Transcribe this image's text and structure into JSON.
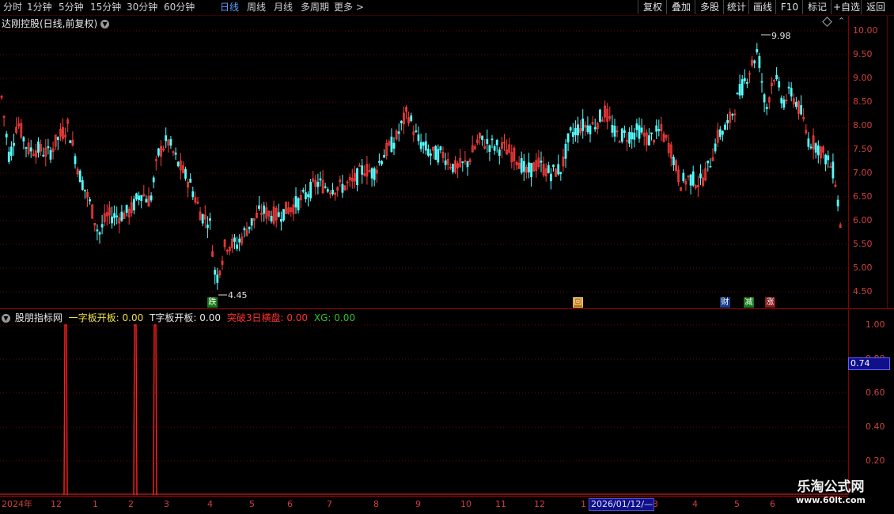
{
  "toolbar": {
    "periods": [
      "分时",
      "1分钟",
      "5分钟",
      "15分钟",
      "30分钟",
      "60分钟",
      "日线",
      "周线",
      "月线",
      "多周期",
      "更多 >"
    ],
    "active_period": "日线",
    "right_buttons": [
      "复权",
      "叠加",
      "多股",
      "统计",
      "画线",
      "F10",
      "标记",
      "+自选",
      "返回"
    ]
  },
  "chart_title": "达刚控股(日线,前复权)",
  "price_axis": {
    "ticks": [
      "10.00",
      "9.50",
      "9.00",
      "8.50",
      "8.00",
      "7.50",
      "7.00",
      "6.50",
      "6.00",
      "5.50",
      "5.00",
      "4.50"
    ]
  },
  "annotations": {
    "high": "9.98",
    "low": "4.45"
  },
  "markers": [
    "跌",
    "回",
    "财",
    "减",
    "涨"
  ],
  "indicator": {
    "name": "股朋指标网",
    "items": [
      {
        "label": "一字板开板: 0.00",
        "color": "#f0e040"
      },
      {
        "label": "T字板开板: 0.00",
        "color": "#e8e8e8"
      },
      {
        "label": "突破3日横盘: 0.00",
        "color": "#ff3030"
      },
      {
        "label": "XG: 0.00",
        "color": "#30c030"
      }
    ],
    "axis_ticks": [
      "1.00",
      "0.80",
      "0.60",
      "0.40",
      "0.20"
    ],
    "cursor_value": "0.74"
  },
  "x_axis": {
    "labels": [
      "2024年",
      "12",
      "1",
      "2",
      "3",
      "4",
      "5",
      "6",
      "7",
      "8",
      "9",
      "10",
      "11",
      "12",
      "1",
      "3",
      "4",
      "5",
      "6"
    ],
    "cursor_date": "2026/01/12/—"
  },
  "watermark": {
    "line1": "乐淘公式网",
    "line2": "www.60lt.com"
  },
  "colors": {
    "up": "#ff3c3c",
    "down": "#54ffff",
    "grid": "#7a0000",
    "axis": "#a00000"
  }
}
